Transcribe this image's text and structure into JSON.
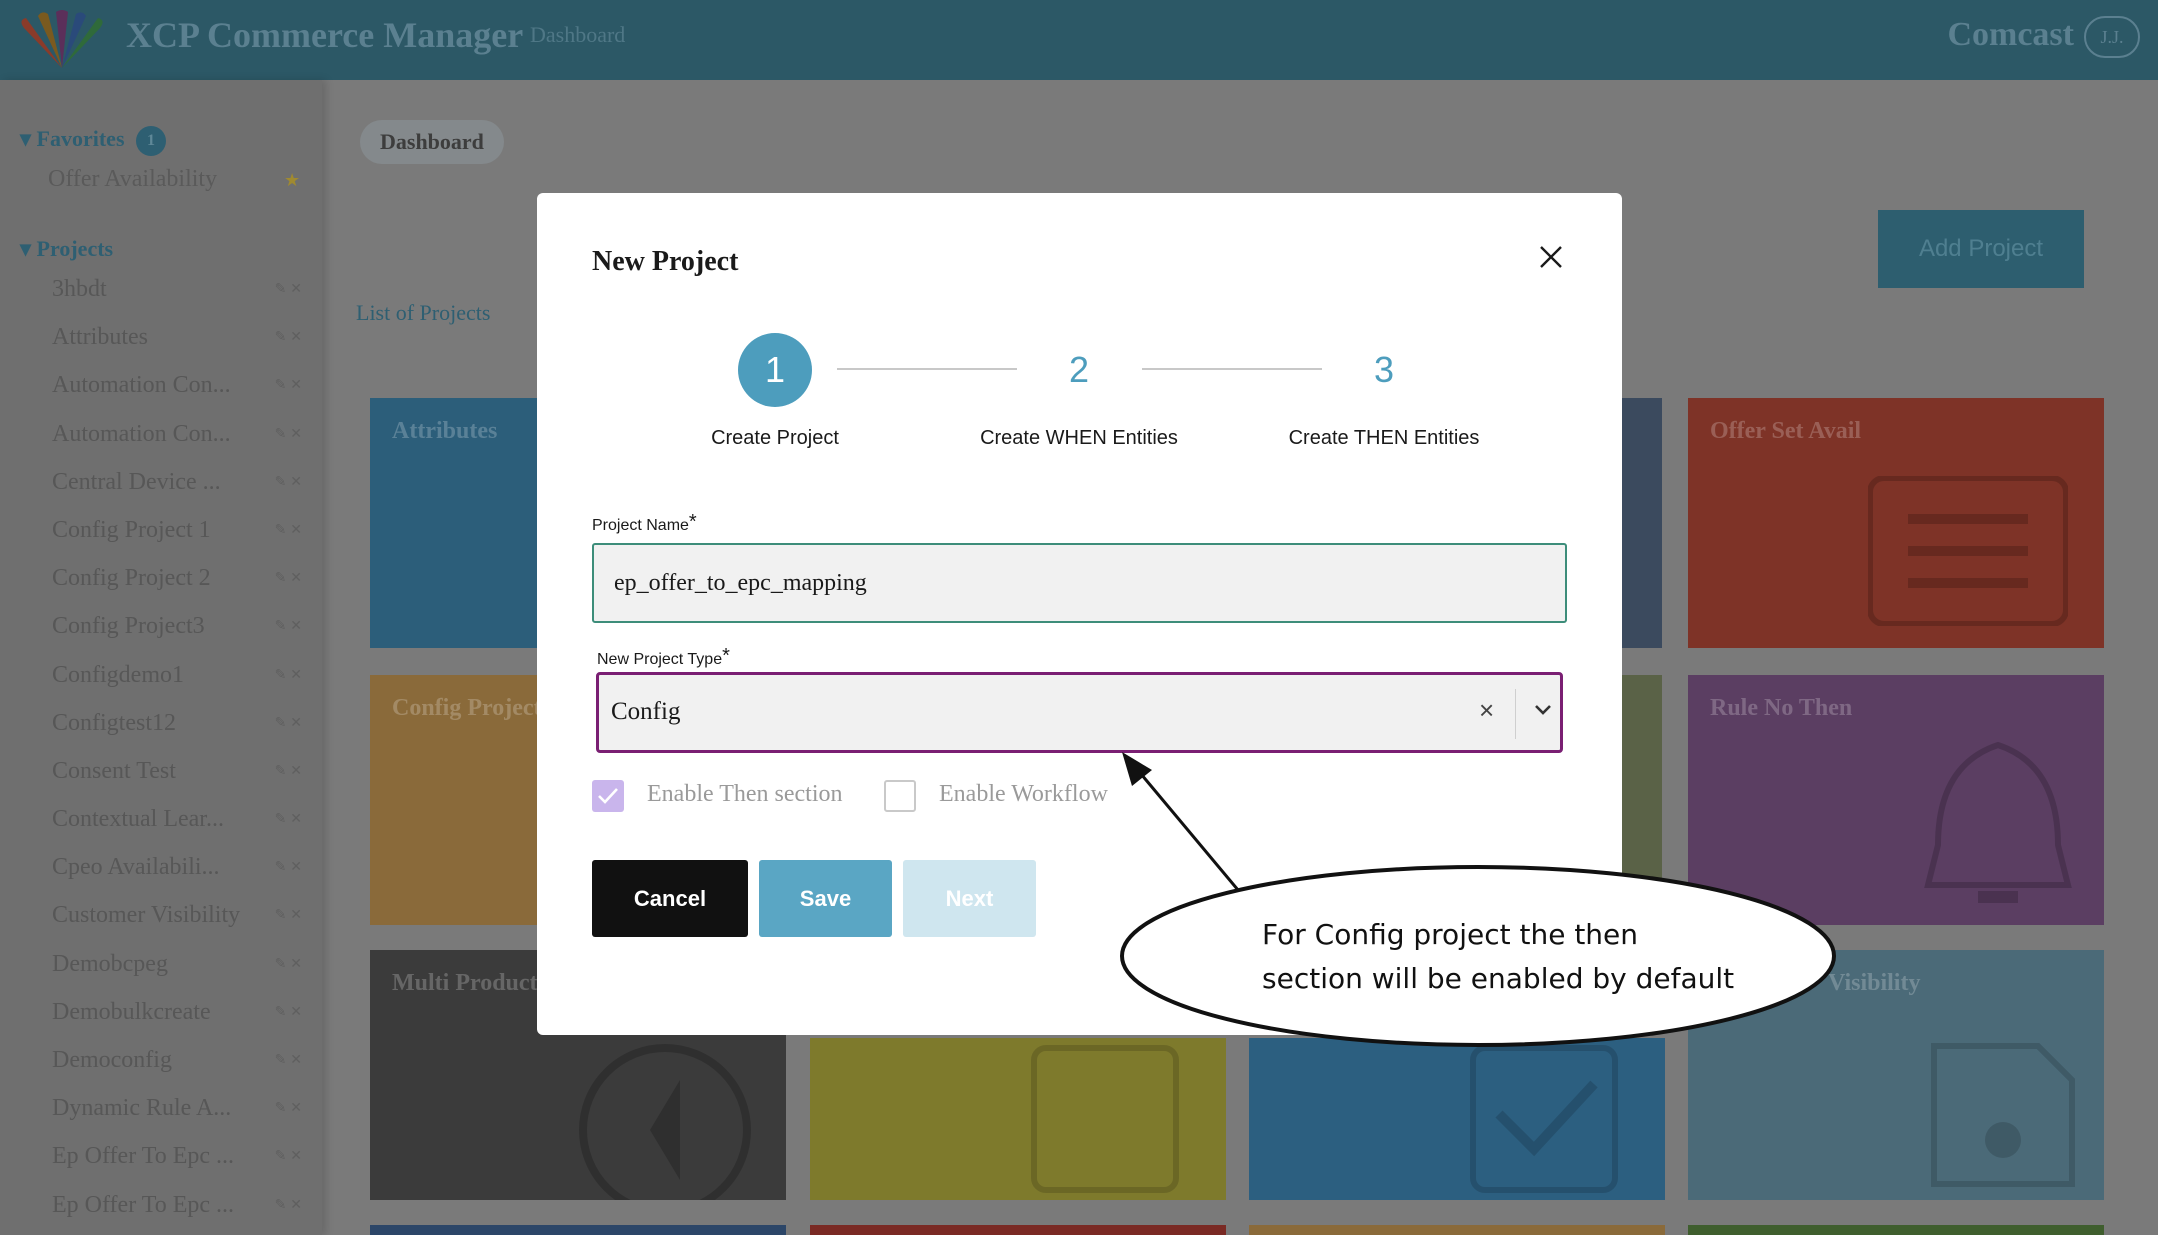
{
  "app": {
    "title": "XCP Commerce Manager",
    "nav_dashboard": "Dashboard",
    "org_name": "Comcast",
    "user_initials": "J.J."
  },
  "sidebar": {
    "favorites_label": "▾ Favorites",
    "favorites_count": "1",
    "favorite_item": "Offer Availability",
    "projects_label": "▾ Projects",
    "projects": [
      "3hbdt",
      "Attributes",
      "Automation Con...",
      "Automation Con...",
      "Central Device ...",
      "Config Project 1",
      "Config Project 2",
      "Config Project3",
      "Configdemo1",
      "Configtest12",
      "Consent Test",
      "Contextual Lear...",
      "Cpeo Availabili...",
      "Customer Visibility",
      "Demobcpeg",
      "Demobulkcreate",
      "Democonfig",
      "Dynamic Rule A...",
      "Ep Offer To Epc ...",
      "Ep Offer To Epc ..."
    ],
    "item_controls": "✎ ✕"
  },
  "dashboard": {
    "breadcrumb": "Dashboard",
    "list_link": "List of Projects",
    "add_project": "Add Project",
    "tiles": [
      "Attributes",
      "Offer Set Avail",
      "Config Project",
      "Rule No Then",
      "Multi Product",
      "Visibility"
    ]
  },
  "modal": {
    "title": "New Project",
    "steps": [
      {
        "number": "1",
        "label": "Create Project"
      },
      {
        "number": "2",
        "label": "Create WHEN Entities"
      },
      {
        "number": "3",
        "label": "Create THEN Entities"
      }
    ],
    "project_name_label": "Project Name",
    "project_name_value": "ep_offer_to_epc_mapping",
    "required_mark": "*",
    "project_type_label": "New Project Type",
    "project_type_value": "Config",
    "clear_glyph": "×",
    "enable_then_label": "Enable Then section",
    "enable_then_checked": true,
    "enable_workflow_label": "Enable Workflow",
    "enable_workflow_checked": false,
    "cancel_label": "Cancel",
    "save_label": "Save",
    "next_label": "Next"
  },
  "annotation": {
    "line1": "For Config project the then",
    "line2": "section will be enabled by default"
  },
  "colors": {
    "accent": "#4d9dbd",
    "save": "#5aa6c4",
    "next_disabled": "#cfe6ef",
    "select_border": "#7a1f73",
    "input_border": "#3d8d7a",
    "checkbox_on": "#c9b5ec"
  }
}
